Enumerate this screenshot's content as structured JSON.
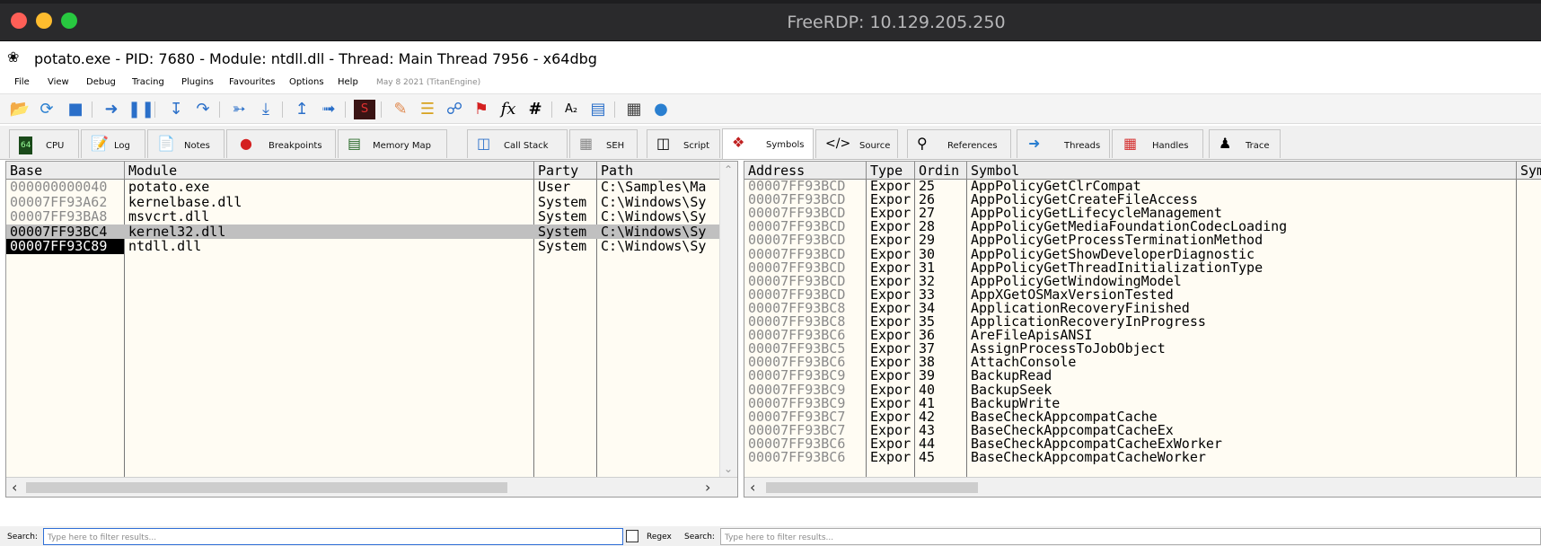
{
  "mac_window": {
    "title": "FreeRDP: 10.129.205.250"
  },
  "app": {
    "title": "potato.exe - PID: 7680 - Module: ntdll.dll - Thread: Main Thread 7956 - x64dbg",
    "icon": "bug-icon"
  },
  "menu": {
    "items": [
      "File",
      "View",
      "Debug",
      "Tracing",
      "Plugins",
      "Favourites",
      "Options",
      "Help"
    ],
    "build_date": "May 8 2021 (TitanEngine)"
  },
  "toolbar": {
    "icons": [
      "open-folder-icon",
      "restart-icon",
      "stop-icon",
      "run-icon",
      "pause-icon",
      "step-into-icon",
      "step-over-icon",
      "trace-into-icon",
      "trace-over-icon",
      "execute-till-return-icon",
      "run-to-user-code-icon",
      "scylla-icon",
      "patch-icon",
      "comments-icon",
      "labels-icon",
      "bookmarks-icon",
      "functions-icon",
      "variables-icon",
      "strings-icon",
      "calculator-icon",
      "globe-icon"
    ],
    "fx_label": "fx",
    "hash_label": "#",
    "az_label": "A₂"
  },
  "tabs": [
    {
      "label": "CPU",
      "icon": "cpu-icon"
    },
    {
      "label": "Log",
      "icon": "log-icon"
    },
    {
      "label": "Notes",
      "icon": "notes-icon"
    },
    {
      "label": "Breakpoints",
      "icon": "breakpoint-icon"
    },
    {
      "label": "Memory Map",
      "icon": "memory-map-icon"
    },
    {
      "label": "Call Stack",
      "icon": "call-stack-icon"
    },
    {
      "label": "SEH",
      "icon": "seh-icon"
    },
    {
      "label": "Script",
      "icon": "script-icon"
    },
    {
      "label": "Symbols",
      "icon": "symbols-icon",
      "active": true
    },
    {
      "label": "Source",
      "icon": "source-icon"
    },
    {
      "label": "References",
      "icon": "references-icon"
    },
    {
      "label": "Threads",
      "icon": "threads-icon"
    },
    {
      "label": "Handles",
      "icon": "handles-icon"
    },
    {
      "label": "Trace",
      "icon": "trace-icon"
    }
  ],
  "modules": {
    "columns": [
      "Base",
      "Module",
      "Party",
      "Path"
    ],
    "rows": [
      {
        "base": "000000000040",
        "module": "potato.exe",
        "party": "User",
        "path": "C:\\Samples\\Ma"
      },
      {
        "base": "00007FF93A62",
        "module": "kernelbase.dll",
        "party": "System",
        "path": "C:\\Windows\\Sy"
      },
      {
        "base": "00007FF93BA8",
        "module": "msvcrt.dll",
        "party": "System",
        "path": "C:\\Windows\\Sy"
      },
      {
        "base": "00007FF93BC4",
        "module": "kernel32.dll",
        "party": "System",
        "path": "C:\\Windows\\Sy",
        "state": "highlighted"
      },
      {
        "base": "00007FF93C89",
        "module": "ntdll.dll",
        "party": "System",
        "path": "C:\\Windows\\Sy",
        "state": "current"
      }
    ]
  },
  "symbols": {
    "columns": [
      "Address",
      "Type",
      "Ordin",
      "Symbol",
      "Sym"
    ],
    "rows": [
      {
        "address": "00007FF93BCD",
        "type": "Expor",
        "ordinal": "25",
        "symbol": "AppPolicyGetClrCompat"
      },
      {
        "address": "00007FF93BCD",
        "type": "Expor",
        "ordinal": "26",
        "symbol": "AppPolicyGetCreateFileAccess"
      },
      {
        "address": "00007FF93BCD",
        "type": "Expor",
        "ordinal": "27",
        "symbol": "AppPolicyGetLifecycleManagement"
      },
      {
        "address": "00007FF93BCD",
        "type": "Expor",
        "ordinal": "28",
        "symbol": "AppPolicyGetMediaFoundationCodecLoading"
      },
      {
        "address": "00007FF93BCD",
        "type": "Expor",
        "ordinal": "29",
        "symbol": "AppPolicyGetProcessTerminationMethod"
      },
      {
        "address": "00007FF93BCD",
        "type": "Expor",
        "ordinal": "30",
        "symbol": "AppPolicyGetShowDeveloperDiagnostic"
      },
      {
        "address": "00007FF93BCD",
        "type": "Expor",
        "ordinal": "31",
        "symbol": "AppPolicyGetThreadInitializationType"
      },
      {
        "address": "00007FF93BCD",
        "type": "Expor",
        "ordinal": "32",
        "symbol": "AppPolicyGetWindowingModel"
      },
      {
        "address": "00007FF93BCD",
        "type": "Expor",
        "ordinal": "33",
        "symbol": "AppXGetOSMaxVersionTested"
      },
      {
        "address": "00007FF93BC8",
        "type": "Expor",
        "ordinal": "34",
        "symbol": "ApplicationRecoveryFinished"
      },
      {
        "address": "00007FF93BC8",
        "type": "Expor",
        "ordinal": "35",
        "symbol": "ApplicationRecoveryInProgress"
      },
      {
        "address": "00007FF93BC6",
        "type": "Expor",
        "ordinal": "36",
        "symbol": "AreFileApisANSI"
      },
      {
        "address": "00007FF93BC5",
        "type": "Expor",
        "ordinal": "37",
        "symbol": "AssignProcessToJobObject"
      },
      {
        "address": "00007FF93BC6",
        "type": "Expor",
        "ordinal": "38",
        "symbol": "AttachConsole"
      },
      {
        "address": "00007FF93BC9",
        "type": "Expor",
        "ordinal": "39",
        "symbol": "BackupRead"
      },
      {
        "address": "00007FF93BC9",
        "type": "Expor",
        "ordinal": "40",
        "symbol": "BackupSeek"
      },
      {
        "address": "00007FF93BC9",
        "type": "Expor",
        "ordinal": "41",
        "symbol": "BackupWrite"
      },
      {
        "address": "00007FF93BC7",
        "type": "Expor",
        "ordinal": "42",
        "symbol": "BaseCheckAppcompatCache"
      },
      {
        "address": "00007FF93BC7",
        "type": "Expor",
        "ordinal": "43",
        "symbol": "BaseCheckAppcompatCacheEx"
      },
      {
        "address": "00007FF93BC6",
        "type": "Expor",
        "ordinal": "44",
        "symbol": "BaseCheckAppcompatCacheExWorker"
      },
      {
        "address": "00007FF93BC6",
        "type": "Expor",
        "ordinal": "45",
        "symbol": "BaseCheckAppcompatCacheWorker"
      }
    ]
  },
  "search": {
    "left_label": "Search:",
    "left_placeholder": "Type here to filter results...",
    "regex_label": "Regex",
    "right_label": "Search:",
    "right_placeholder": "Type here to filter results..."
  },
  "colors": {
    "pane_background": "#fffcf3",
    "selected_row": "#c0c0c0",
    "current_module": "#000000",
    "address_text": "#8a8a8a"
  }
}
